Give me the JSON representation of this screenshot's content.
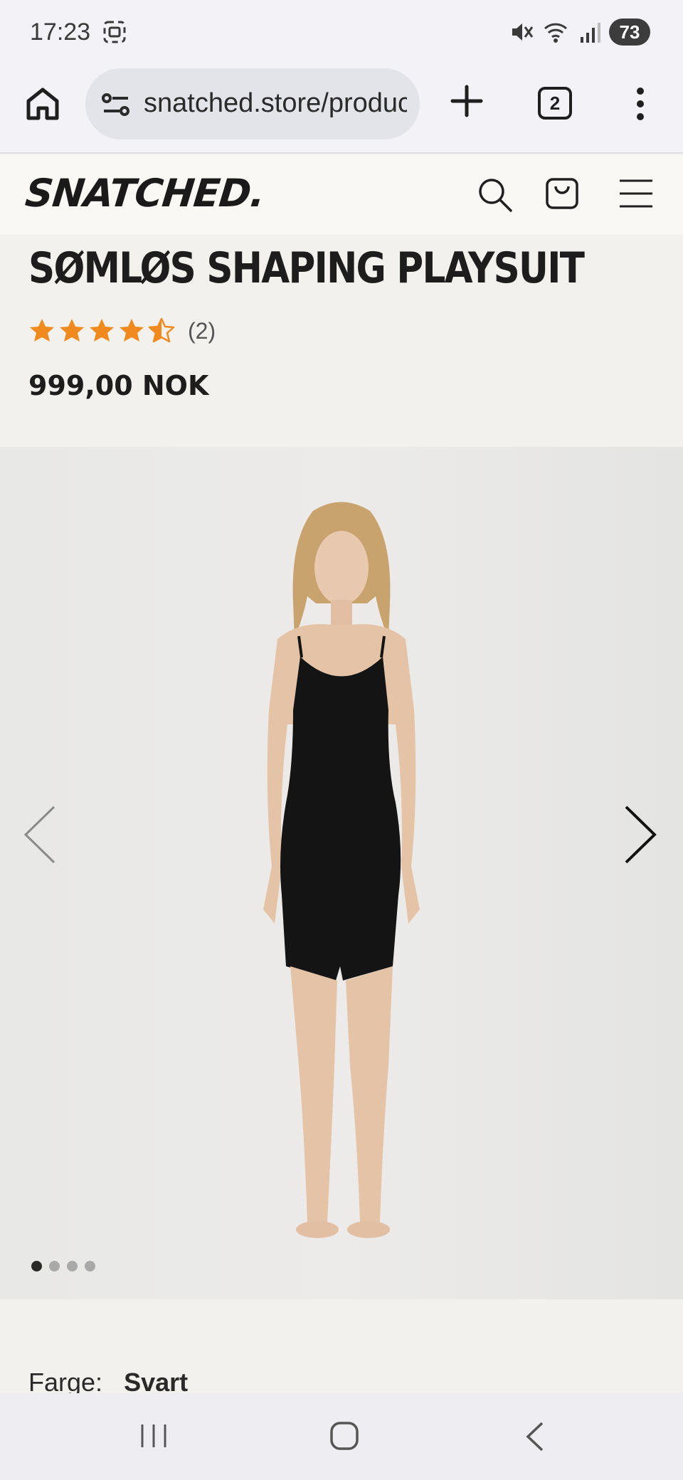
{
  "status_bar": {
    "time": "17:23",
    "battery": "73"
  },
  "browser": {
    "url": "snatched.store/products/somlos-shaping-playsuit",
    "tab_count": "2"
  },
  "site": {
    "logo": "SNATCHED",
    "logo_dot": "."
  },
  "product": {
    "title": "SØMLØS SHAPING PLAYSUIT",
    "rating": 4.5,
    "rating_max": 5,
    "review_count": "(2)",
    "price": "999,00 NOK",
    "color_label": "Farge:",
    "color_value": "Svart"
  },
  "gallery": {
    "image_count": 4,
    "active_index": 0
  },
  "colors": {
    "star": "#f08a1e",
    "accent_dark": "#1d1d1d"
  }
}
